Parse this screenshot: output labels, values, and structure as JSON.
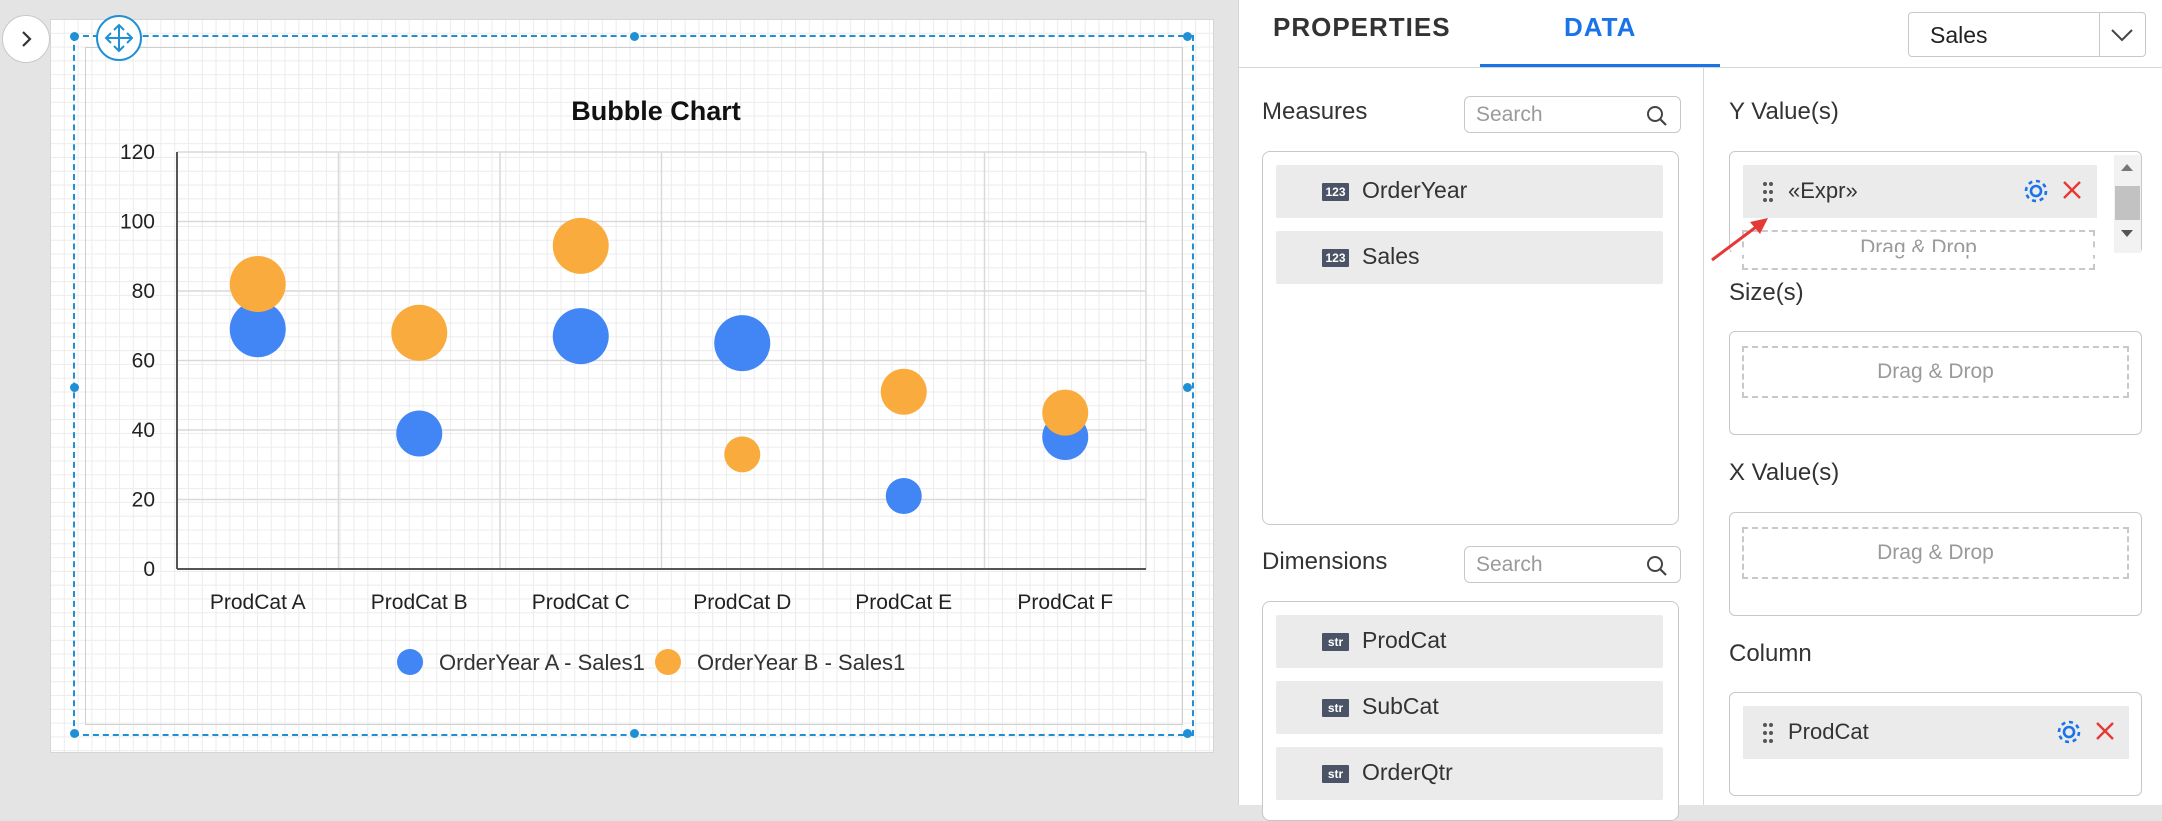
{
  "tabs": {
    "properties": "PROPERTIES",
    "data": "DATA"
  },
  "datasource": {
    "selected": "Sales"
  },
  "icons": {
    "expand": "chevron-right-icon",
    "move": "move-icon",
    "search": "search-icon",
    "grip": "grip-icon",
    "gear": "gear-icon",
    "remove": "close-icon",
    "dropdown": "chevron-down-icon"
  },
  "colors": {
    "accent": "#1a73e8",
    "series1": "#4285f4",
    "series2": "#f9ac3d",
    "remove": "#e53935",
    "selection": "#1f90d6"
  },
  "chart_data": {
    "type": "bubble",
    "title": "Bubble Chart",
    "categories": [
      "ProdCat A",
      "ProdCat B",
      "ProdCat C",
      "ProdCat D",
      "ProdCat E",
      "ProdCat F"
    ],
    "ylim": [
      0,
      120
    ],
    "yticks": [
      "0",
      "20",
      "40",
      "60",
      "80",
      "100",
      "120"
    ],
    "grid": true,
    "legend_position": "bottom",
    "series": [
      {
        "name": "OrderYear A - Sales1",
        "values": [
          69,
          39,
          67,
          65,
          21,
          38
        ],
        "sizes": [
          3,
          2,
          3,
          3,
          1,
          2
        ]
      },
      {
        "name": "OrderYear B - Sales1",
        "values": [
          82,
          68,
          93,
          33,
          51,
          45
        ],
        "sizes": [
          3,
          3,
          3,
          1,
          2,
          2
        ]
      }
    ]
  },
  "measures": {
    "label": "Measures",
    "search_placeholder": "Search",
    "items": [
      {
        "type": "123",
        "label": "OrderYear"
      },
      {
        "type": "123",
        "label": "Sales"
      }
    ]
  },
  "dimensions": {
    "label": "Dimensions",
    "search_placeholder": "Search",
    "items": [
      {
        "type": "str",
        "label": "ProdCat"
      },
      {
        "type": "str",
        "label": "SubCat"
      },
      {
        "type": "str",
        "label": "OrderQtr"
      }
    ]
  },
  "binding": {
    "y_values": {
      "label": "Y Value(s)",
      "item": "«Expr»",
      "drop_text": "Drag & Drop"
    },
    "sizes": {
      "label": "Size(s)",
      "drop_text": "Drag & Drop"
    },
    "x_values": {
      "label": "X Value(s)",
      "drop_text": "Drag & Drop"
    },
    "column": {
      "label": "Column",
      "item": "ProdCat"
    }
  }
}
